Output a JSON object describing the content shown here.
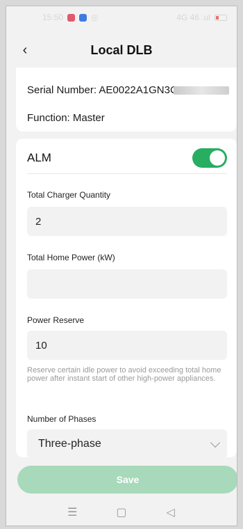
{
  "status_bar": {
    "time": "15:50",
    "right_text": "4G 46 .ul"
  },
  "header": {
    "title": "Local DLB",
    "back_icon": "chevron-left-icon"
  },
  "device": {
    "serial_label": "Serial Number: AE0022A1GN3C",
    "function_label": "Function: Master"
  },
  "alm": {
    "label": "ALM",
    "enabled": true,
    "color": "#27ae60"
  },
  "fields": {
    "charger_quantity": {
      "label": "Total Charger Quantity",
      "value": "2"
    },
    "home_power": {
      "label": "Total Home Power (kW)",
      "value": ""
    },
    "power_reserve": {
      "label": "Power Reserve",
      "value": "10",
      "hint": "Reserve certain idle power to avoid exceeding total home power after instant start of other high-power appliances."
    },
    "phases": {
      "label": "Number of Phases",
      "value": "Three-phase"
    }
  },
  "save_button": {
    "label": "Save",
    "color": "#a7d9ba"
  },
  "nav": {
    "menu": "☰",
    "home": "▢",
    "back": "◁"
  }
}
